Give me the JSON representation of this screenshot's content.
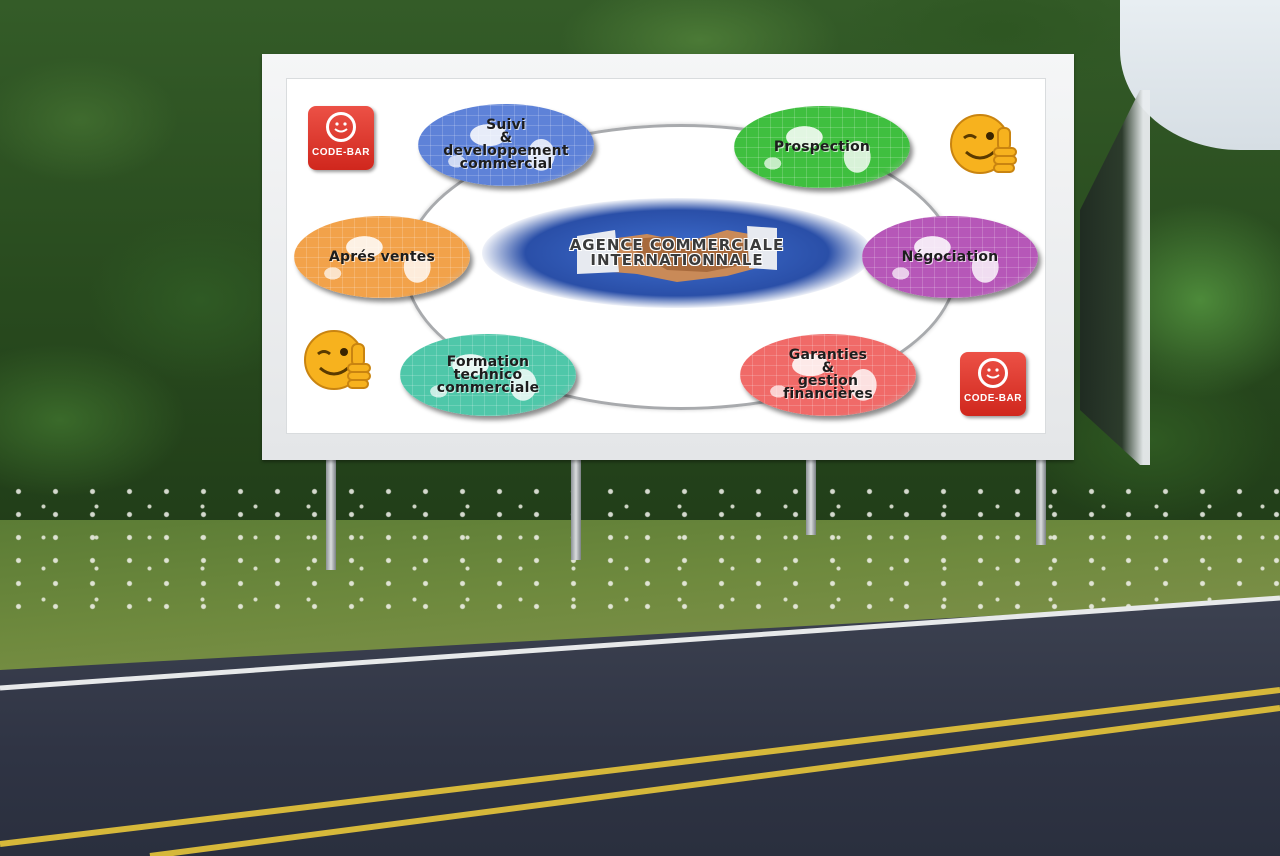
{
  "billboard": {
    "center_title": "AGENCE COMMERCIALE\nINTERNATIONNALE",
    "globes": [
      {
        "key": "suivi",
        "label": "Suivi\n&\ndeveloppement\ncommercial",
        "color": "#5e82d8"
      },
      {
        "key": "prospection",
        "label": "Prospection",
        "color": "#3fbf3f"
      },
      {
        "key": "apres",
        "label": "Aprés ventes",
        "color": "#f2a24a"
      },
      {
        "key": "negociation",
        "label": "Négociation",
        "color": "#b657b8"
      },
      {
        "key": "formation",
        "label": "Formation\ntechnico\ncommerciale",
        "color": "#4fc7a9"
      },
      {
        "key": "garanties",
        "label": "Garanties\n&\ngestion\nfinancières",
        "color": "#f06a68"
      }
    ],
    "badge_label": "CODE-BAR",
    "badge_color": "#d0271d",
    "emoji_icon": "winking-thumbs-up-icon",
    "badge_icon": "smiley-icon"
  }
}
